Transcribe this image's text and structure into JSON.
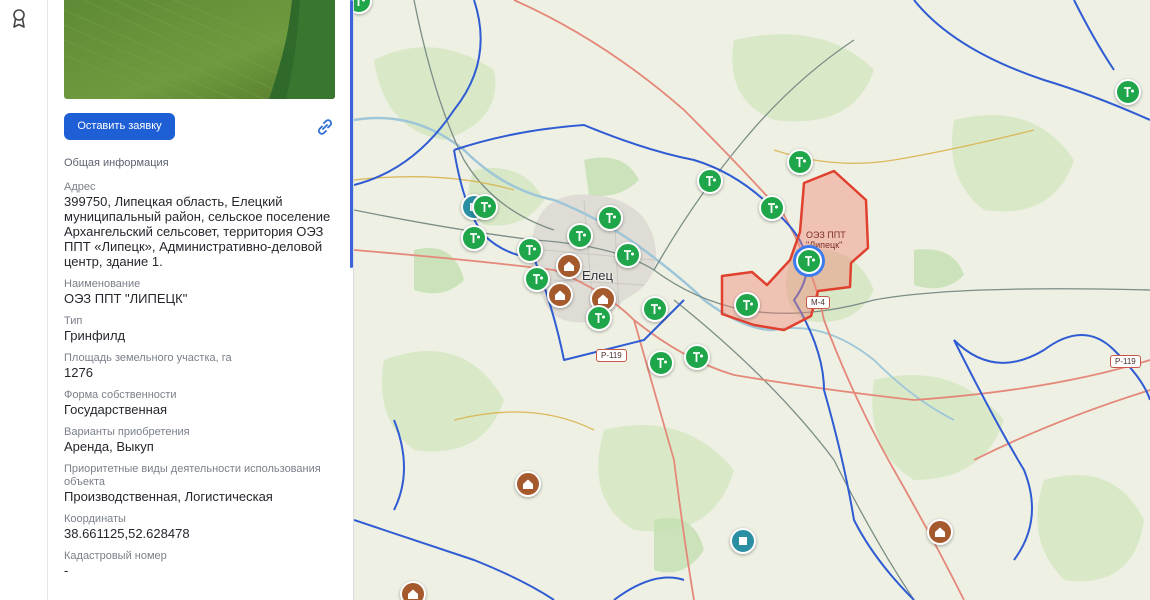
{
  "rail": {
    "icon": "award-icon"
  },
  "panel": {
    "apply_button": "Оставить заявку",
    "link_icon": "link-icon",
    "section_title": "Общая информация",
    "fields": [
      {
        "label": "Адрес",
        "value": "399750, Липецкая область, Елецкий муниципальный район, сельское поселение Архангельский сельсовет, территория ОЭЗ ППТ «Липецк», Административно-деловой центр, здание 1."
      },
      {
        "label": "Наименование",
        "value": "ОЭЗ ППТ \"ЛИПЕЦК\""
      },
      {
        "label": "Тип",
        "value": "Гринфилд"
      },
      {
        "label": "Площадь земельного участка, га",
        "value": "1276"
      },
      {
        "label": "Форма собственности",
        "value": "Государственная"
      },
      {
        "label": "Варианты приобретения",
        "value": "Аренда, Выкуп"
      },
      {
        "label": "Приоритетные виды деятельности использования объекта",
        "value": "Производственная, Логистическая"
      },
      {
        "label": "Координаты",
        "value": "38.661125,52.628478"
      },
      {
        "label": "Кадастровый номер",
        "value": "-"
      }
    ]
  },
  "map": {
    "city": "Елец",
    "zone_label_1": "ОЭЗ ППТ",
    "zone_label_2": "\"Липецк\"",
    "roads": {
      "r119_a": "Р-119",
      "r119_b": "Р-119",
      "m4": "М-4"
    },
    "colors": {
      "zone_fill": "#f08a7a",
      "zone_stroke": "#e0402e",
      "boundary": "#2f5bd3",
      "marker_green": "#1fa64a",
      "marker_brown": "#a55a2e",
      "marker_teal": "#2a8fa3"
    }
  }
}
